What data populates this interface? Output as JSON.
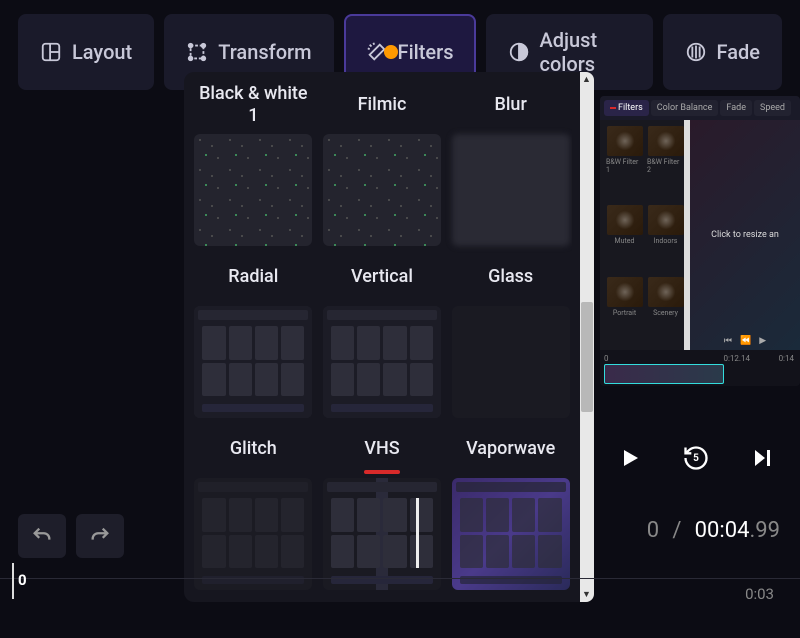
{
  "toolbar": {
    "layout": "Layout",
    "transform": "Transform",
    "filters": "Filters",
    "adjust": "Adjust colors",
    "fade": "Fade"
  },
  "filters": {
    "items": [
      {
        "label": "Black & white 1"
      },
      {
        "label": "Filmic"
      },
      {
        "label": "Blur"
      },
      {
        "label": "Radial"
      },
      {
        "label": "Vertical"
      },
      {
        "label": "Glass"
      },
      {
        "label": "Glitch"
      },
      {
        "label": "VHS",
        "highlighted": true
      },
      {
        "label": "Vaporwave"
      }
    ]
  },
  "preview": {
    "tabs": {
      "filters": "Filters",
      "color": "Color Balance",
      "fade": "Fade",
      "speed": "Speed"
    },
    "thumbs": [
      "B&W Filter 1",
      "B&W Filter 2",
      "Muted",
      "Indoors",
      "Portrait",
      "Scenery"
    ],
    "hint": "Click to resize an",
    "timecode": "0:12.14",
    "tl_marks": [
      "0",
      "0:14"
    ]
  },
  "time": {
    "sep": "/",
    "cur": "00:04",
    "frac": ".99",
    "total_prefix": "0"
  },
  "ruler": {
    "t0": "0",
    "t1": "0:03"
  }
}
